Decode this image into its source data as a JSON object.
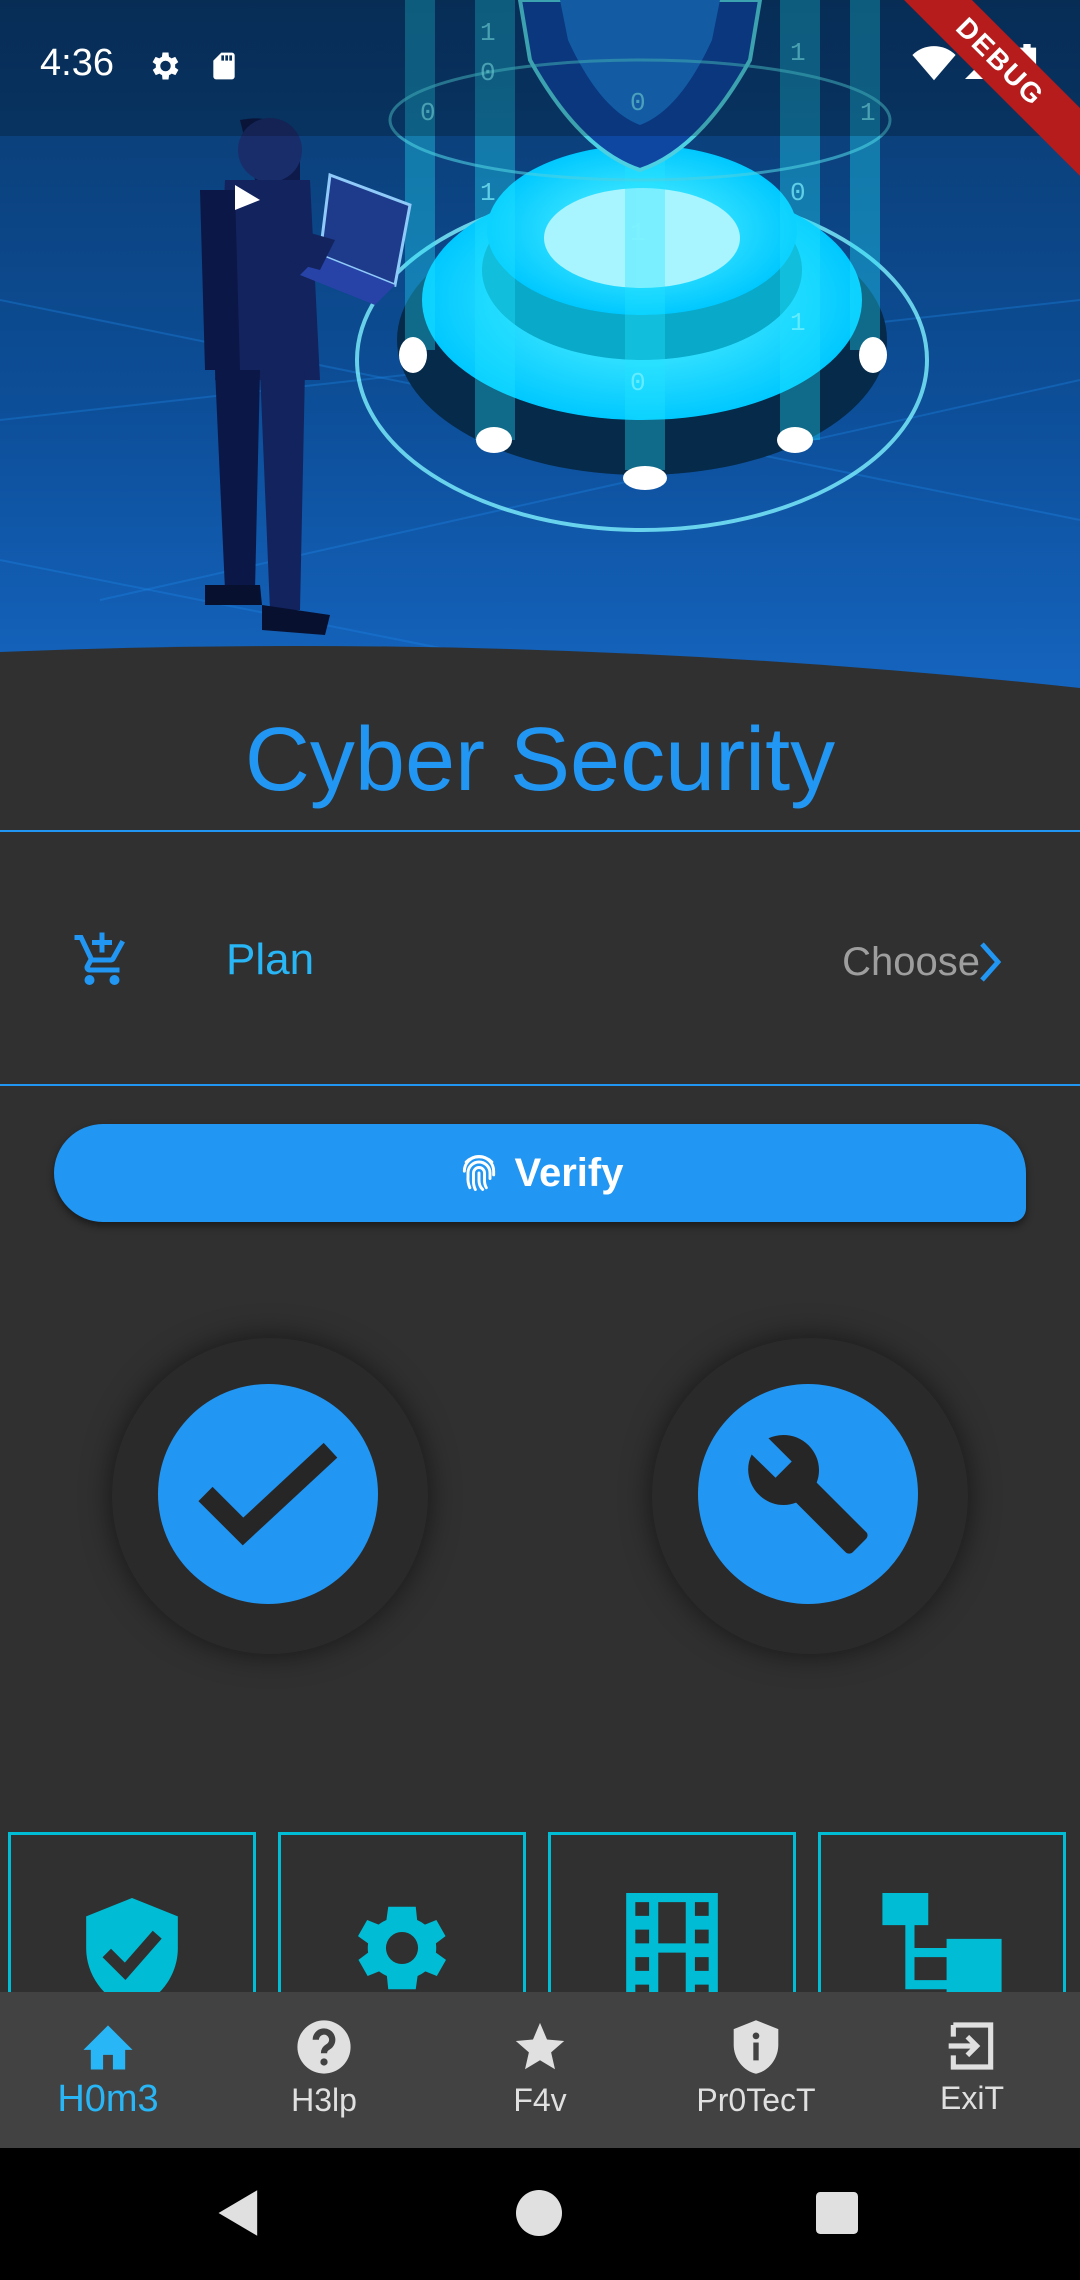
{
  "status_bar": {
    "time": "4:36",
    "icons": [
      "gear-icon",
      "sd-card-icon",
      "wifi-icon",
      "signal-icon",
      "battery-icon"
    ],
    "debug_banner": "DEBUG"
  },
  "header": {
    "title": "Cyber Security"
  },
  "plan_row": {
    "icon": "add-shopping-cart-icon",
    "label": "Plan",
    "action_label": "Choose",
    "action_icon": "chevron-right-icon"
  },
  "verify_button": {
    "label": "Verify",
    "icon": "fingerprint-icon"
  },
  "action_circles": [
    {
      "icon": "check-icon"
    },
    {
      "icon": "wrench-icon"
    }
  ],
  "grid_cards": [
    {
      "icon": "shield-check-icon"
    },
    {
      "icon": "gear-icon"
    },
    {
      "icon": "film-icon"
    },
    {
      "icon": "hierarchy-icon"
    }
  ],
  "bottom_nav": {
    "items": [
      {
        "label": "H0m3",
        "icon": "home-icon",
        "active": true
      },
      {
        "label": "H3lp",
        "icon": "help-icon",
        "active": false
      },
      {
        "label": "F4v",
        "icon": "star-icon",
        "active": false
      },
      {
        "label": "Pr0TecT",
        "icon": "shield-info-icon",
        "active": false
      },
      {
        "label": "ExiT",
        "icon": "exit-icon",
        "active": false
      }
    ]
  },
  "colors": {
    "accent": "#2196f3",
    "accent_light": "#29b6f6",
    "cyan": "#00bcd4",
    "background": "#303030",
    "nav_background": "#424242"
  }
}
